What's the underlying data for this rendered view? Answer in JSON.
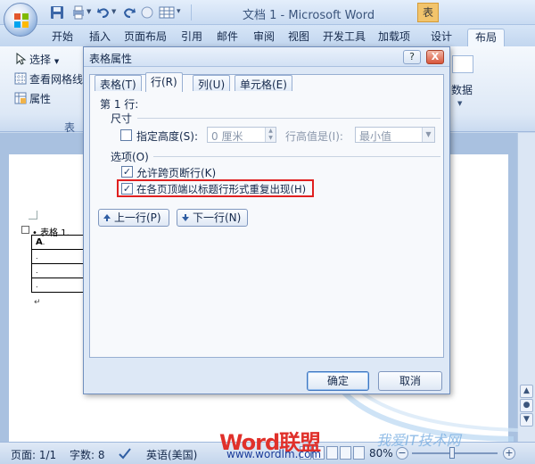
{
  "window": {
    "title": "文档 1 - Microsoft Word",
    "tools_label": "表"
  },
  "ribbon_tabs": [
    "开始",
    "插入",
    "页面布局",
    "引用",
    "邮件",
    "审阅",
    "视图",
    "开发工具",
    "加载项",
    "设计",
    "布局"
  ],
  "active_tab": "布局",
  "ribbon": {
    "select_label": "选择",
    "gridlines_label": "查看网格线",
    "properties_label": "属性",
    "group_label": "表",
    "right_partial_label": "数据"
  },
  "dialog": {
    "title": "表格属性",
    "help_button": "?",
    "close_button": "X",
    "tabs": [
      "表格(T)",
      "行(R)",
      "列(U)",
      "单元格(E)"
    ],
    "active_tab": "行(R)",
    "row_label": "第 1 行:",
    "size_section": "尺寸",
    "specify_height_label": "指定高度(S):",
    "specify_height_checked": false,
    "height_value": "0 厘米",
    "row_height_is_label": "行高值是(I):",
    "row_height_mode": "最小值",
    "options_section": "选项(O)",
    "allow_break_label": "允许跨页断行(K)",
    "allow_break_checked": true,
    "repeat_header_label": "在各页顶端以标题行形式重复出现(H)",
    "repeat_header_checked": true,
    "prev_row_button": "上一行(P)",
    "next_row_button": "下一行(N)",
    "ok_button": "确定",
    "cancel_button": "取消"
  },
  "document": {
    "caption": "表格 1",
    "table_first_cell": "A"
  },
  "statusbar": {
    "page": "页面: 1/1",
    "words": "字数: 8",
    "language": "英语(美国)",
    "zoom": "80%"
  },
  "watermarks": {
    "word_logo": "Word联盟",
    "url": "www.wordlm.com",
    "right_logo": "我爱IT技术网"
  },
  "colors": {
    "highlight": "#e02020",
    "accent": "#3f76c0"
  }
}
